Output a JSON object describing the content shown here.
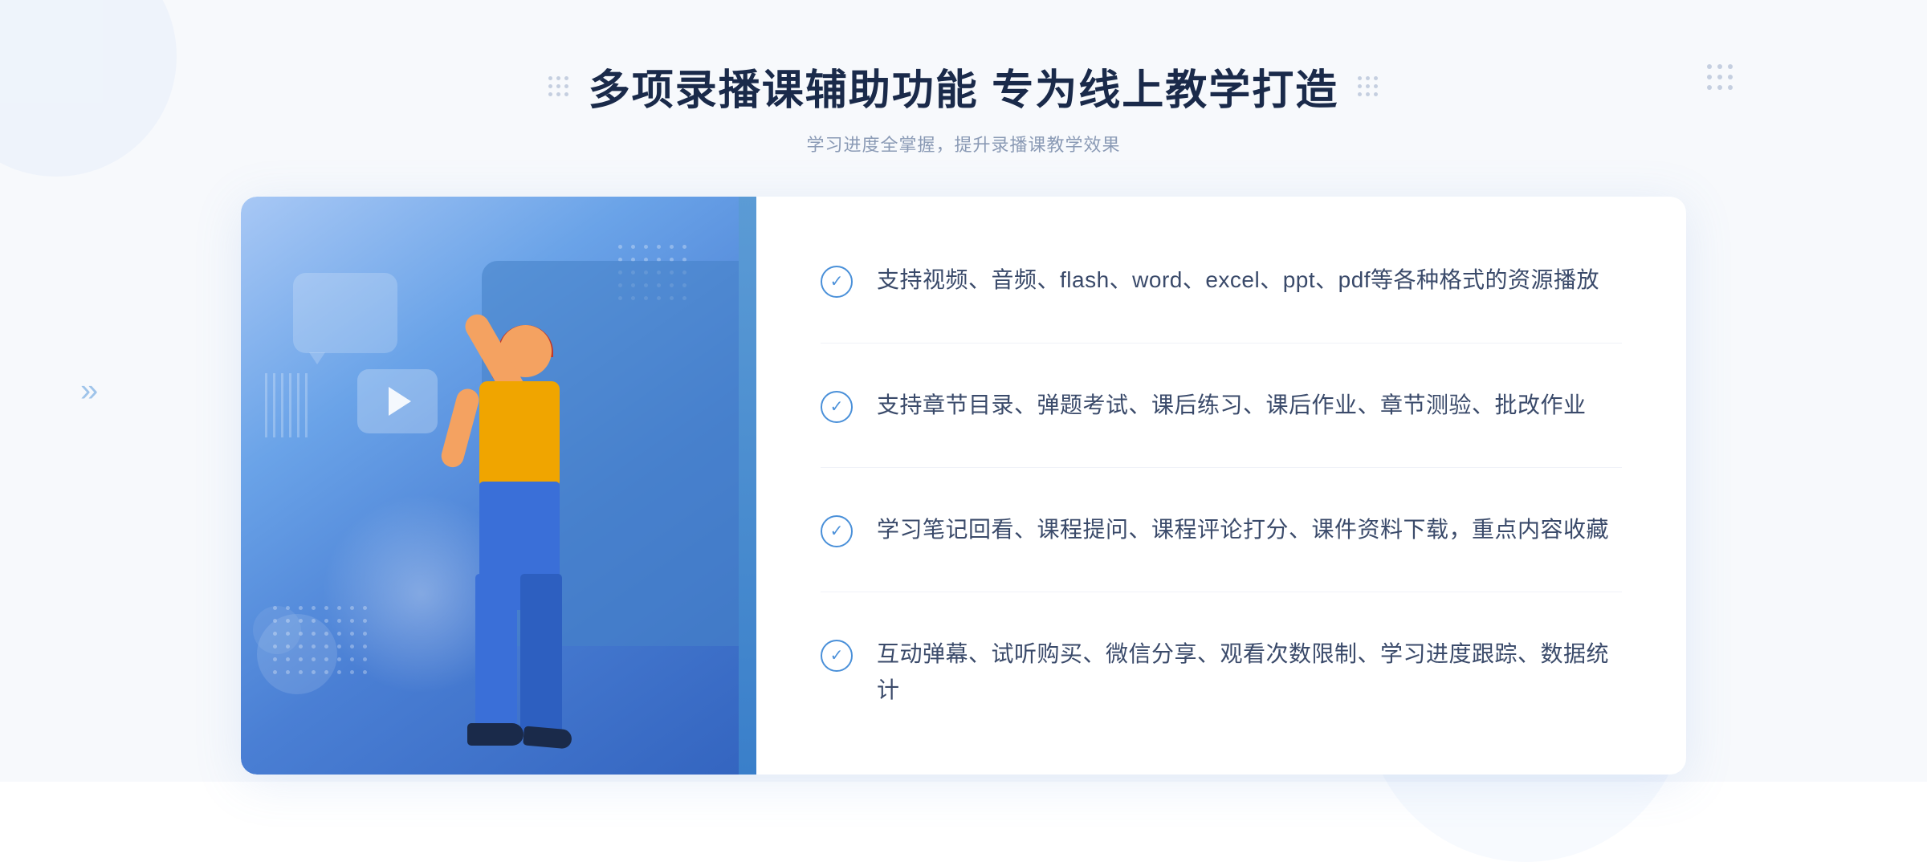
{
  "page": {
    "background": "#f7f9fc"
  },
  "header": {
    "title": "多项录播课辅助功能 专为线上教学打造",
    "subtitle": "学习进度全掌握，提升录播课教学效果",
    "deco_left": "⁞⁞",
    "deco_right": "⁞⁞"
  },
  "features": [
    {
      "id": 1,
      "text": "支持视频、音频、flash、word、excel、ppt、pdf等各种格式的资源播放"
    },
    {
      "id": 2,
      "text": "支持章节目录、弹题考试、课后练习、课后作业、章节测验、批改作业"
    },
    {
      "id": 3,
      "text": "学习笔记回看、课程提问、课程评论打分、课件资料下载，重点内容收藏"
    },
    {
      "id": 4,
      "text": "互动弹幕、试听购买、微信分享、观看次数限制、学习进度跟踪、数据统计"
    }
  ],
  "left_arrow": "»",
  "colors": {
    "primary_blue": "#4a90d9",
    "dark_blue": "#3a6fd8",
    "text_dark": "#3a4a6a",
    "text_light": "#8a9ab5",
    "check_color": "#4a90d9"
  }
}
